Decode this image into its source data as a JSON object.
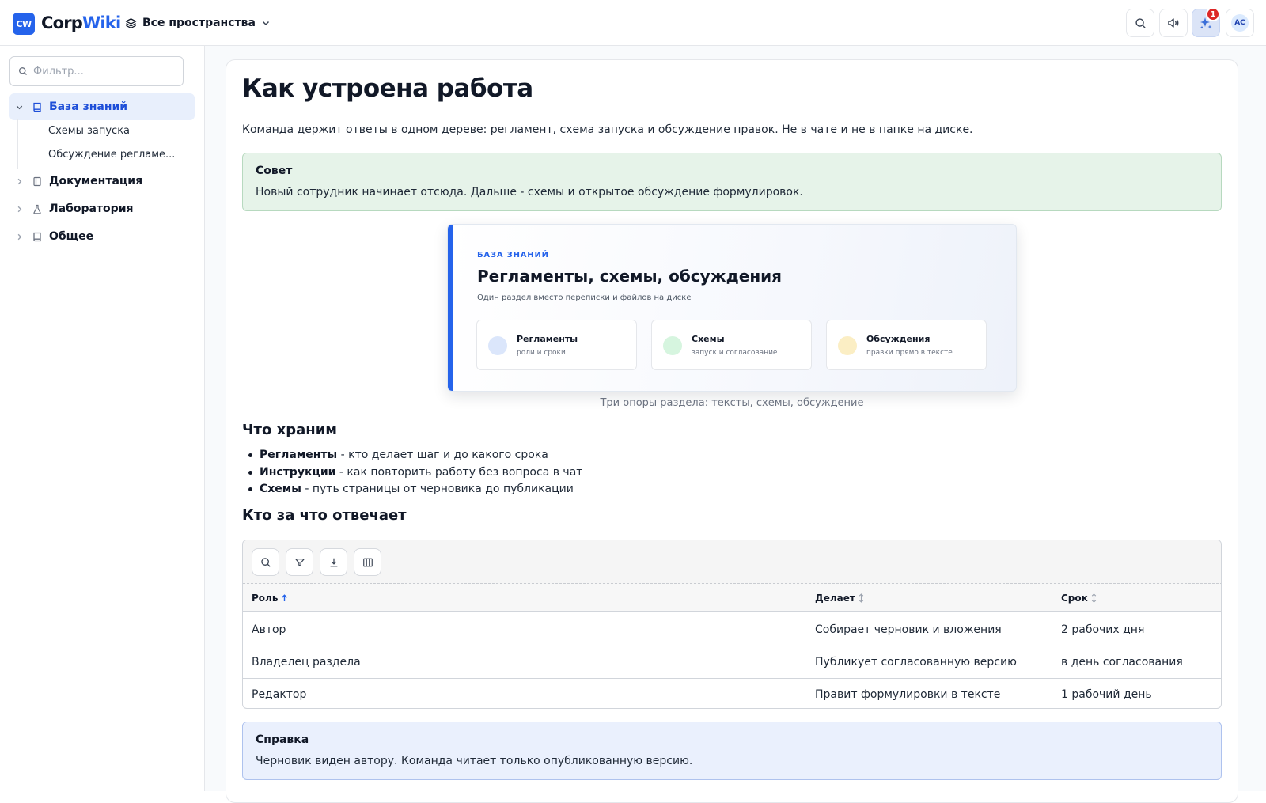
{
  "header": {
    "logo_badge": "CW",
    "brand_part1": "Corp",
    "brand_part2": "Wiki",
    "space_switcher": "Все пространства",
    "notifications_count": "1",
    "avatar_initials": "AC",
    "icons": [
      "layers-icon",
      "chevron-down-icon",
      "search-icon",
      "speaker-icon",
      "sparkles-icon"
    ]
  },
  "sidebar": {
    "filter_placeholder": "Фильтр...",
    "items": [
      {
        "label": "База знаний",
        "expanded": true,
        "active": true,
        "icon": "book-icon",
        "children": [
          {
            "label": "Схемы запуска"
          },
          {
            "label": "Обсуждение регламе..."
          }
        ]
      },
      {
        "label": "Документация",
        "expanded": false,
        "icon": "notebook-icon"
      },
      {
        "label": "Лаборатория",
        "expanded": false,
        "icon": "flask-icon"
      },
      {
        "label": "Общее",
        "expanded": false,
        "icon": "book-icon"
      }
    ]
  },
  "page": {
    "title": "Как устроена работа",
    "intro": "Команда держит ответы в одном дереве: регламент, схема запуска и обсуждение правок. Не в чате и не в папке на диске.",
    "tip": {
      "title": "Совет",
      "body": "Новый сотрудник начинает отсюда. Дальше - схемы и открытое обсуждение формулировок."
    },
    "hero": {
      "eyebrow": "БАЗА ЗНАНИЙ",
      "heading": "Регламенты, схемы, обсуждения",
      "subtitle": "Один раздел вместо переписки и файлов на диске",
      "pills": [
        {
          "title": "Регламенты",
          "subtitle": "роли и сроки",
          "color": "#dbe6fb"
        },
        {
          "title": "Схемы",
          "subtitle": "запуск и согласование",
          "color": "#d6f5df"
        },
        {
          "title": "Обсуждения",
          "subtitle": "правки прямо в тексте",
          "color": "#fbeec4"
        }
      ],
      "caption": "Три опоры раздела: тексты, схемы, обсуждение"
    },
    "store_heading": "Что храним",
    "bullets": [
      {
        "term": "Регламенты",
        "desc": " - кто делает шаг и до какого срока"
      },
      {
        "term": "Инструкции",
        "desc": " - как повторить работу без вопроса в чат"
      },
      {
        "term": "Схемы",
        "desc": " - путь страницы от черновика до публикации"
      }
    ],
    "who_heading": "Кто за что отвечает",
    "table": {
      "toolbar_icons": [
        "search-icon",
        "filter-icon",
        "download-icon",
        "columns-icon"
      ],
      "columns": [
        {
          "label": "Роль",
          "sort": "asc"
        },
        {
          "label": "Делает",
          "sort": "none"
        },
        {
          "label": "Срок",
          "sort": "none"
        }
      ],
      "rows": [
        [
          "Автор",
          "Собирает черновик и вложения",
          "2 рабочих дня"
        ],
        [
          "Владелец раздела",
          "Публикует согласованную версию",
          "в день согласования"
        ],
        [
          "Редактор",
          "Правит формулировки в тексте",
          "1 рабочий день"
        ]
      ]
    },
    "note": {
      "title": "Справка",
      "body": "Черновик виден автору. Команда читает только опубликованную версию."
    }
  },
  "colors": {
    "accent": "#2563eb",
    "tip_bg": "#e6f3e9",
    "note_bg": "#eaf0fd",
    "badge": "#dc2626"
  }
}
